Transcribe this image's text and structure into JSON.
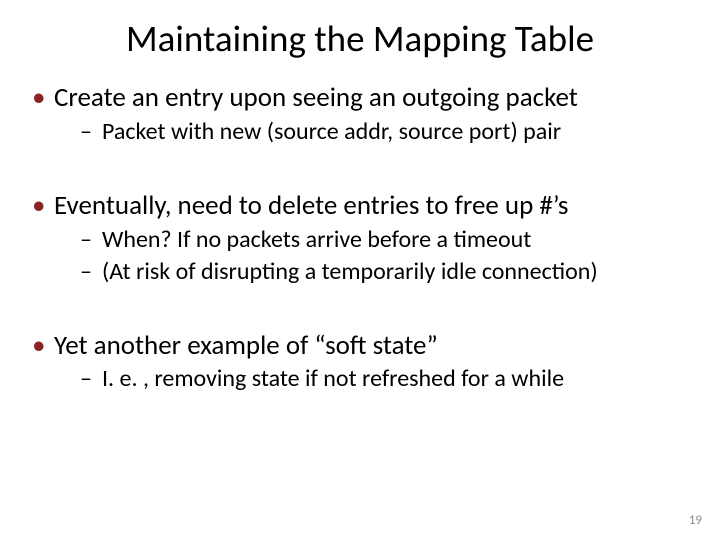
{
  "title": "Maintaining the Mapping Table",
  "bullets": [
    {
      "text": "Create an entry upon seeing an outgoing packet",
      "sub": [
        "Packet with new (source addr, source port) pair"
      ]
    },
    {
      "text": "Eventually, need to delete entries to free up #’s",
      "sub": [
        "When?  If no packets arrive before a timeout",
        "(At risk of disrupting a temporarily idle connection)"
      ]
    },
    {
      "text": "Yet another example of “soft state”",
      "sub": [
        "I. e. , removing state if not refreshed for a while"
      ]
    }
  ],
  "page_number": "19"
}
